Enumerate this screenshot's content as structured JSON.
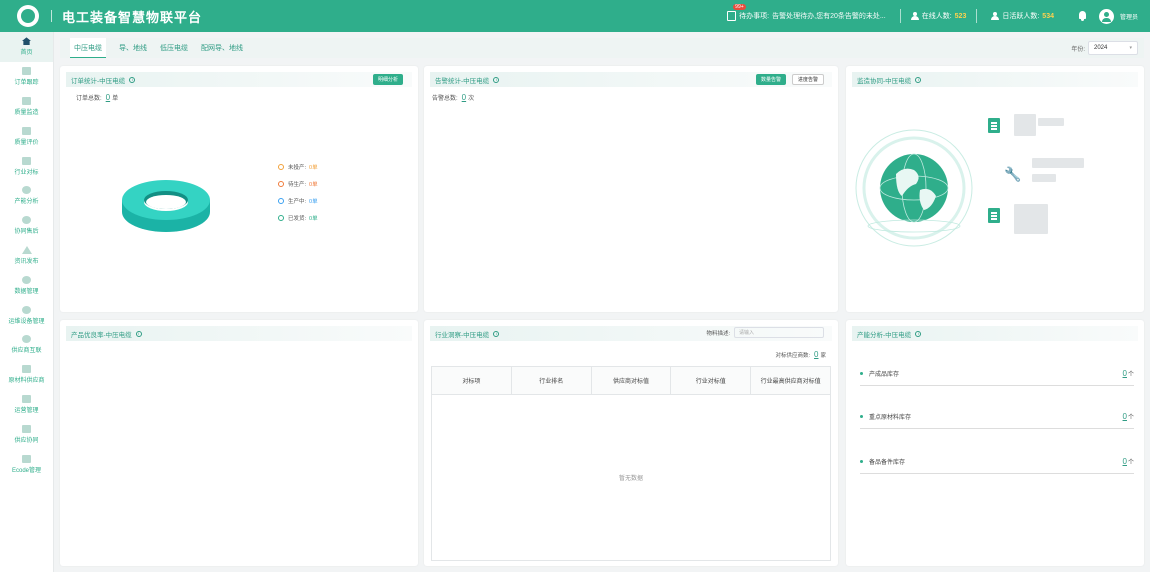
{
  "header": {
    "title": "电工装备智慧物联平台",
    "todo_label": "待办事项:",
    "todo_badge": "99+",
    "todo_text": "告警处理待办,您有20条告警的未处...",
    "online_label": "在线人数:",
    "online_value": "523",
    "daily_label": "日活跃人数:",
    "daily_value": "534",
    "username": "管理员"
  },
  "sidebar": {
    "items": [
      {
        "label": "首页",
        "icon": "home-icon"
      },
      {
        "label": "订单跟踪",
        "icon": "order-icon"
      },
      {
        "label": "质量监造",
        "icon": "quality-icon"
      },
      {
        "label": "质量评价",
        "icon": "evaluate-icon"
      },
      {
        "label": "行业对标",
        "icon": "benchmark-icon"
      },
      {
        "label": "产能分析",
        "icon": "capacity-icon"
      },
      {
        "label": "协同售后",
        "icon": "service-icon"
      },
      {
        "label": "资讯发布",
        "icon": "send-icon"
      },
      {
        "label": "数据管理",
        "icon": "data-icon"
      },
      {
        "label": "运维设备管理",
        "icon": "device-icon"
      },
      {
        "label": "供应商互联",
        "icon": "supplier-icon"
      },
      {
        "label": "原材料供应商",
        "icon": "material-icon"
      },
      {
        "label": "运营管理",
        "icon": "operation-icon"
      },
      {
        "label": "供应协同",
        "icon": "supply-icon"
      },
      {
        "label": "Ecode管理",
        "icon": "ecode-icon"
      }
    ]
  },
  "tabs": [
    "中压电缆",
    "导、地线",
    "低压电缆",
    "配网导、地线"
  ],
  "year": {
    "label": "年份:",
    "value": "2024"
  },
  "order_card": {
    "title": "订单统计-中压电缆",
    "button": "明细分析",
    "total_label": "订单总数:",
    "total_value": "0",
    "total_unit": "单",
    "legend": [
      {
        "label": "未投产:",
        "value": "0单",
        "color": "#f2a13a"
      },
      {
        "label": "待生产:",
        "value": "0单",
        "color": "#f07a3a"
      },
      {
        "label": "生产中:",
        "value": "0单",
        "color": "#3aa0f0"
      },
      {
        "label": "已发货:",
        "value": "0单",
        "color": "#2fae8b"
      }
    ]
  },
  "alarm_card": {
    "title": "告警统计-中压电缆",
    "btn_quantity": "数量告警",
    "btn_progress": "进度告警",
    "total_label": "告警总数:",
    "total_value": "0",
    "total_unit": "次"
  },
  "supervise_card": {
    "title": "监造协同-中压电缆"
  },
  "yield_card": {
    "title": "产品优良率-中压电缆"
  },
  "industry_card": {
    "title": "行业洞察-中压电缆",
    "search_label": "物料描述:",
    "search_placeholder": "请输入",
    "count_label": "对标供应商数:",
    "count_value": "0",
    "count_unit": "家",
    "columns": [
      "对标项",
      "行业排名",
      "供应商对标值",
      "行业对标值",
      "行业最高供应商对标值"
    ],
    "empty_text": "暂无数据"
  },
  "capacity_card": {
    "title": "产能分析-中压电缆",
    "rows": [
      {
        "label": "产成品库存",
        "value": "0",
        "unit": "个"
      },
      {
        "label": "重点原材料库存",
        "value": "0",
        "unit": "个"
      },
      {
        "label": "备品备件库存",
        "value": "0",
        "unit": "个"
      }
    ]
  },
  "colors": {
    "brand": "#2fae8b",
    "ring": "#2fd0c0"
  }
}
